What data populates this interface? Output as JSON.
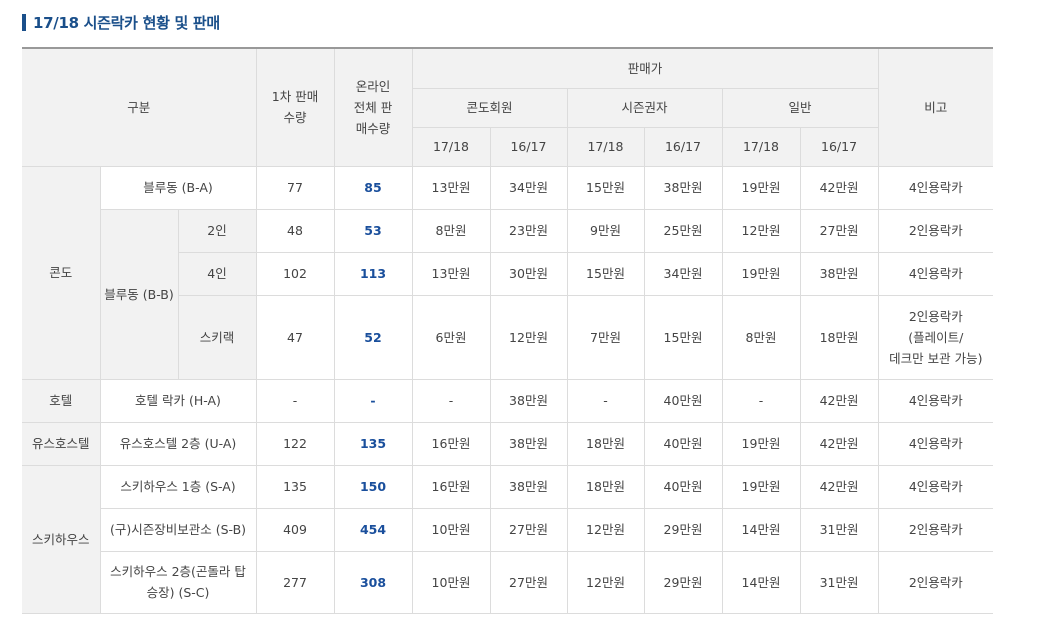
{
  "title": "17/18 시즌락카 현황 및 판매",
  "headers": {
    "category": "구분",
    "first_sale": "1차 판매\n수량",
    "online_sale": "온라인\n전체 판\n매수량",
    "price": "판매가",
    "condo_member": "콘도회원",
    "season_holder": "시즌권자",
    "general": "일반",
    "note": "비고",
    "y1718": "17/18",
    "y1617": "16/17"
  },
  "groups": {
    "condo": "콘도",
    "hotel": "호텔",
    "youth": "유스호스텔",
    "skihouse": "스키하우스"
  },
  "rows": [
    {
      "label": "블루동 (B-A)",
      "first": "77",
      "online": "85",
      "c1": "13만원",
      "c2": "34만원",
      "s1": "15만원",
      "s2": "38만원",
      "g1": "19만원",
      "g2": "42만원",
      "note": "4인용락카"
    },
    {
      "sublabel": "블루동 (B-B)",
      "label": "2인",
      "first": "48",
      "online": "53",
      "c1": "8만원",
      "c2": "23만원",
      "s1": "9만원",
      "s2": "25만원",
      "g1": "12만원",
      "g2": "27만원",
      "note": "2인용락카"
    },
    {
      "label": "4인",
      "first": "102",
      "online": "113",
      "c1": "13만원",
      "c2": "30만원",
      "s1": "15만원",
      "s2": "34만원",
      "g1": "19만원",
      "g2": "38만원",
      "note": "4인용락카"
    },
    {
      "label": "스키랙",
      "first": "47",
      "online": "52",
      "c1": "6만원",
      "c2": "12만원",
      "s1": "7만원",
      "s2": "15만원",
      "g1": "8만원",
      "g2": "18만원",
      "note": "2인용락카\n(플레이트/\n데크만 보관 가능)"
    },
    {
      "label": "호텔 락카 (H-A)",
      "first": "-",
      "online": "-",
      "c1": "-",
      "c2": "38만원",
      "s1": "-",
      "s2": "40만원",
      "g1": "-",
      "g2": "42만원",
      "note": "4인용락카"
    },
    {
      "label": "유스호스텔 2층 (U-A)",
      "first": "122",
      "online": "135",
      "c1": "16만원",
      "c2": "38만원",
      "s1": "18만원",
      "s2": "40만원",
      "g1": "19만원",
      "g2": "42만원",
      "note": "4인용락카"
    },
    {
      "label": "스키하우스 1층 (S-A)",
      "first": "135",
      "online": "150",
      "c1": "16만원",
      "c2": "38만원",
      "s1": "18만원",
      "s2": "40만원",
      "g1": "19만원",
      "g2": "42만원",
      "note": "4인용락카"
    },
    {
      "label": "(구)시즌장비보관소 (S-B)",
      "first": "409",
      "online": "454",
      "c1": "10만원",
      "c2": "27만원",
      "s1": "12만원",
      "s2": "29만원",
      "g1": "14만원",
      "g2": "31만원",
      "note": "2인용락카"
    },
    {
      "label": "스키하우스 2층(곤돌라 탑\n승장) (S-C)",
      "first": "277",
      "online": "308",
      "c1": "10만원",
      "c2": "27만원",
      "s1": "12만원",
      "s2": "29만원",
      "g1": "14만원",
      "g2": "31만원",
      "note": "2인용락카"
    }
  ]
}
